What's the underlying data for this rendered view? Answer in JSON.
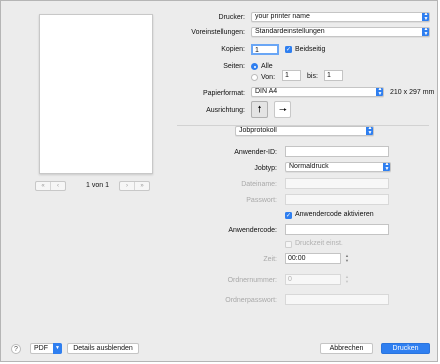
{
  "printer": {
    "label": "Drucker:",
    "value": "your printer name"
  },
  "presets": {
    "label": "Voreinstellungen:",
    "value": "Standardeinstellungen"
  },
  "copies": {
    "label": "Kopien:",
    "value": "1",
    "duplex_label": "Beidseitig",
    "duplex_checked": true
  },
  "pages": {
    "label": "Seiten:",
    "all_label": "Alle",
    "from_label": "Von:",
    "from_value": "1",
    "to_label": "bis:",
    "to_value": "1",
    "selected": "all"
  },
  "paper": {
    "label": "Papierformat:",
    "value": "DIN A4",
    "dims": "210 x 297 mm"
  },
  "orientation": {
    "label": "Ausrichtung:",
    "portrait_icon": "portrait-icon",
    "landscape_icon": "landscape-icon",
    "selected": "portrait"
  },
  "section": {
    "value": "Jobprotokoll"
  },
  "preview": {
    "page_counter": "1 von 1"
  },
  "job": {
    "user_id_label": "Anwender-ID:",
    "job_type_label": "Jobtyp:",
    "job_type_value": "Normaldruck",
    "filename_label": "Dateiname:",
    "password_label": "Passwort:",
    "user_code_check_label": "Anwendercode aktivieren",
    "user_code_checked": true,
    "user_code_label": "Anwendercode:",
    "print_time_check_label": "Druckzeit einst.",
    "print_time_checked": false,
    "time_label": "Zeit:",
    "time_value": "00:00",
    "folder_number_label": "Ordnernummer:",
    "folder_number_value": "0",
    "folder_password_label": "Ordnerpasswort:"
  },
  "footer": {
    "help": "?",
    "pdf_label": "PDF",
    "details_button": "Details ausblenden",
    "cancel_button": "Abbrechen",
    "print_button": "Drucken"
  },
  "colors": {
    "accent": "#2f7ff0",
    "dialog_bg": "#ececec"
  }
}
